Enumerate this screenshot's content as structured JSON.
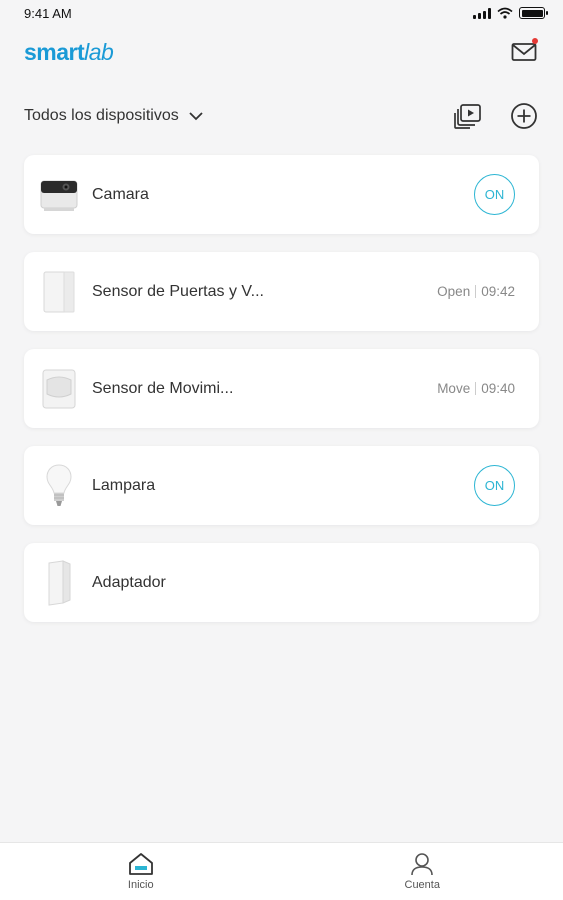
{
  "status_bar": {
    "time": "9:41 AM"
  },
  "header": {
    "logo_part1": "smart",
    "logo_part2": "lab",
    "has_unread": true
  },
  "toolbar": {
    "filter_label": "Todos los dispositivos"
  },
  "devices": [
    {
      "name": "Camara",
      "icon": "camera-icon",
      "control": "ON"
    },
    {
      "name": "Sensor de Puertas y V...",
      "icon": "door-sensor-icon",
      "status": "Open",
      "time": "09:42"
    },
    {
      "name": "Sensor de Movimi...",
      "icon": "motion-sensor-icon",
      "status": "Move",
      "time": "09:40"
    },
    {
      "name": "Lampara",
      "icon": "bulb-icon",
      "control": "ON"
    },
    {
      "name": "Adaptador",
      "icon": "adapter-icon"
    }
  ],
  "tabs": [
    {
      "label": "Inicio",
      "icon": "home-icon",
      "active": true
    },
    {
      "label": "Cuenta",
      "icon": "user-icon",
      "active": false
    }
  ],
  "colors": {
    "brand": "#1a9ad6",
    "accent": "#2cb5d3",
    "notification": "#e53935"
  }
}
